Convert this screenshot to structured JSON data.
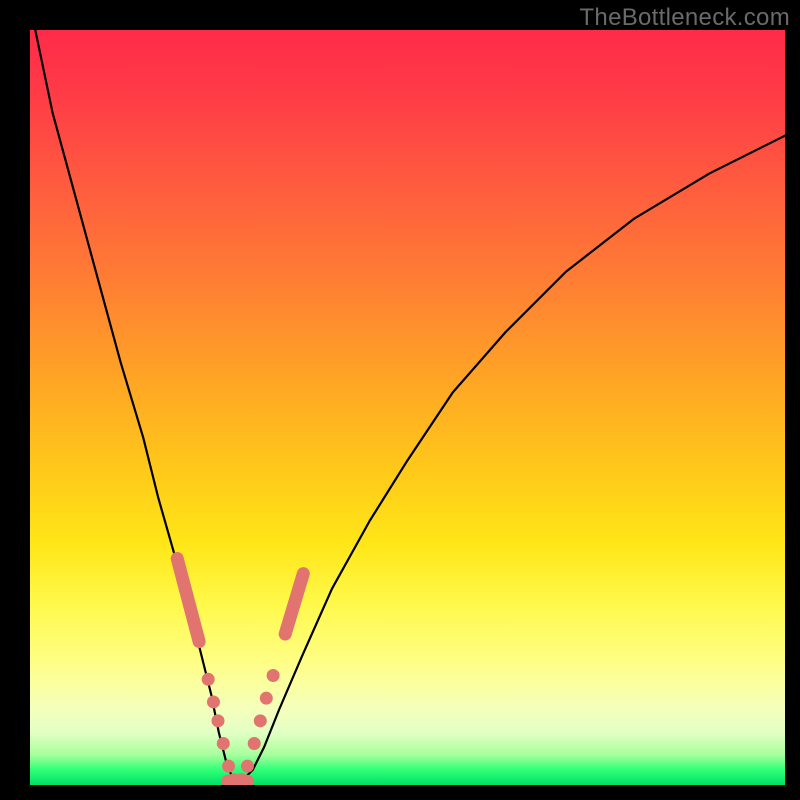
{
  "watermark": "TheBottleneck.com",
  "colors": {
    "frame_bg": "#000000",
    "gradient_top": "#ff2b49",
    "gradient_mid": "#ffe617",
    "gradient_bottom": "#00e066",
    "curve": "#000000",
    "marker": "#e2746f"
  },
  "chart_data": {
    "type": "line",
    "title": "",
    "xlabel": "",
    "ylabel": "",
    "xlim": [
      0,
      100
    ],
    "ylim": [
      0,
      100
    ],
    "grid": false,
    "legend": false,
    "series": [
      {
        "name": "bottleneck-curve",
        "x": [
          0.7,
          3,
          6,
          9,
          12,
          15,
          17,
          19,
          21,
          22.5,
          24,
          25,
          26,
          27,
          28,
          29.5,
          31,
          33,
          36,
          40,
          45,
          50,
          56,
          63,
          71,
          80,
          90,
          100
        ],
        "y": [
          100,
          89,
          78,
          67,
          56,
          46,
          38,
          31,
          24,
          18,
          12,
          7,
          3,
          0.5,
          0.5,
          2,
          5,
          10,
          17,
          26,
          35,
          43,
          52,
          60,
          68,
          75,
          81,
          86
        ]
      }
    ],
    "markers": {
      "left_branch": [
        {
          "x": 19.5,
          "y": 30
        },
        {
          "x": 20.3,
          "y": 27
        },
        {
          "x": 21.0,
          "y": 24
        },
        {
          "x": 21.7,
          "y": 21.5
        },
        {
          "x": 22.4,
          "y": 19
        },
        {
          "x": 23.6,
          "y": 14
        },
        {
          "x": 24.3,
          "y": 11
        },
        {
          "x": 24.9,
          "y": 8.5
        },
        {
          "x": 25.6,
          "y": 5.5
        },
        {
          "x": 26.3,
          "y": 2.5
        },
        {
          "x": 27.0,
          "y": 0.7
        }
      ],
      "right_branch": [
        {
          "x": 28.0,
          "y": 0.7
        },
        {
          "x": 28.8,
          "y": 2.5
        },
        {
          "x": 29.7,
          "y": 5.5
        },
        {
          "x": 30.5,
          "y": 8.5
        },
        {
          "x": 31.3,
          "y": 11.5
        },
        {
          "x": 32.2,
          "y": 14.5
        },
        {
          "x": 33.8,
          "y": 20
        },
        {
          "x": 34.6,
          "y": 23
        },
        {
          "x": 35.4,
          "y": 25.5
        },
        {
          "x": 36.2,
          "y": 28
        }
      ],
      "bottom": [
        {
          "x": 26.2,
          "y": 0.5
        },
        {
          "x": 27.5,
          "y": 0.5
        },
        {
          "x": 28.8,
          "y": 0.5
        }
      ]
    }
  }
}
